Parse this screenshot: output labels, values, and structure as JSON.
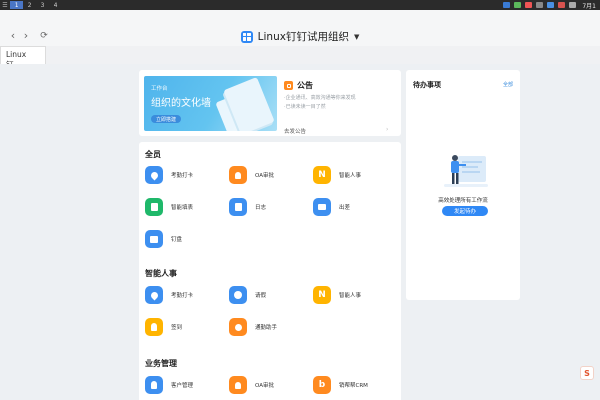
{
  "system_bar": {
    "workspaces": [
      "1",
      "2",
      "3",
      "4"
    ],
    "active_workspace": "1",
    "clock": "7月1",
    "accent": "#4a76c6"
  },
  "window": {
    "title": "Linux钉钉试用组织",
    "brand_color": "#2f88f5"
  },
  "tabs": [
    {
      "label": "Linux钉..."
    }
  ],
  "announcement": {
    "banner_small": "工作台",
    "banner_title": "组织的文化墙",
    "banner_button": "立即搭建",
    "title": "公告",
    "lines": [
      "·企业通讯、高效沟通等你来发现",
      "·已读未读一目了然"
    ],
    "more": "去发公告"
  },
  "sections": [
    {
      "title": "全员",
      "apps": [
        {
          "label": "考勤打卡",
          "icon": "location-pin-icon",
          "color": "#3d8ff0"
        },
        {
          "label": "OA审批",
          "icon": "person-stamp-icon",
          "color": "#ff8a1f"
        },
        {
          "label": "智能人事",
          "icon": "n-letter-icon",
          "color": "#ffb400"
        },
        {
          "label": "智能填表",
          "icon": "form-icon",
          "color": "#1fb86a"
        },
        {
          "label": "日志",
          "icon": "pen-note-icon",
          "color": "#3d8ff0"
        },
        {
          "label": "出差",
          "icon": "suitcase-icon",
          "color": "#3d8ff0"
        },
        {
          "label": "钉盘",
          "icon": "folder-check-icon",
          "color": "#3d8ff0"
        }
      ]
    },
    {
      "title": "智能人事",
      "apps": [
        {
          "label": "考勤打卡",
          "icon": "location-pin-icon",
          "color": "#3d8ff0"
        },
        {
          "label": "请假",
          "icon": "clock-icon",
          "color": "#3d8ff0"
        },
        {
          "label": "智能人事",
          "icon": "n-letter-icon",
          "color": "#ffb400"
        },
        {
          "label": "签到",
          "icon": "lightbulb-pin-icon",
          "color": "#ffb400"
        },
        {
          "label": "通勤助手",
          "icon": "location-target-icon",
          "color": "#ff8a1f"
        }
      ]
    },
    {
      "title": "业务管理",
      "apps": [
        {
          "label": "客户管理",
          "icon": "contact-icon",
          "color": "#3d8ff0"
        },
        {
          "label": "OA审批",
          "icon": "person-stamp-icon",
          "color": "#ff8a1f"
        },
        {
          "label": "销帮帮CRM",
          "icon": "b-letter-icon",
          "color": "#ff8a1f"
        }
      ]
    }
  ],
  "todo": {
    "title": "待办事项",
    "all_link": "全部",
    "empty_text": "高效处理所有工作流",
    "button": "发起待办"
  }
}
